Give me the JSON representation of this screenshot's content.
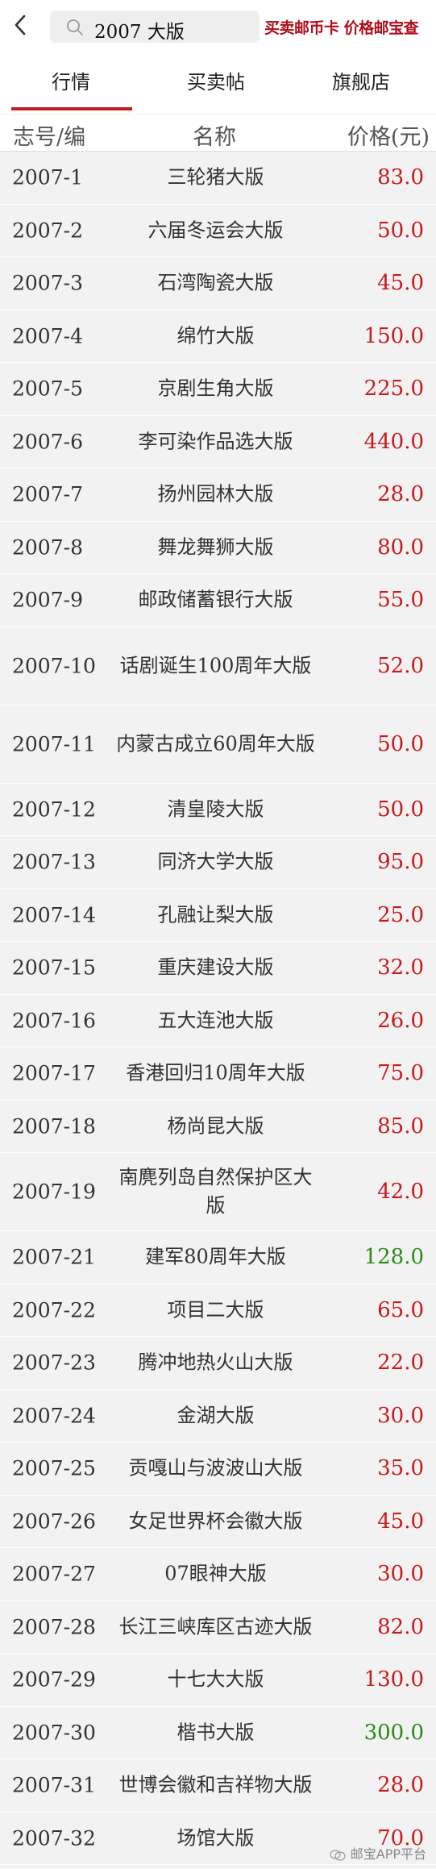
{
  "search": {
    "query": "2007 大版"
  },
  "promo": {
    "text": "买卖邮币卡 价格邮宝查"
  },
  "tabs": [
    {
      "label": "行情"
    },
    {
      "label": "买卖帖"
    },
    {
      "label": "旗舰店"
    }
  ],
  "columns": [
    "志号/编",
    "名称",
    "价格(元)"
  ],
  "rows": [
    {
      "code": "2007-1",
      "name": "三轮猪大版",
      "price": "83.0",
      "color": "red"
    },
    {
      "code": "2007-2",
      "name": "六届冬运会大版",
      "price": "50.0",
      "color": "red"
    },
    {
      "code": "2007-3",
      "name": "石湾陶瓷大版",
      "price": "45.0",
      "color": "red"
    },
    {
      "code": "2007-4",
      "name": "绵竹大版",
      "price": "150.0",
      "color": "red"
    },
    {
      "code": "2007-5",
      "name": "京剧生角大版",
      "price": "225.0",
      "color": "red"
    },
    {
      "code": "2007-6",
      "name": "李可染作品选大版",
      "price": "440.0",
      "color": "red"
    },
    {
      "code": "2007-7",
      "name": "扬州园林大版",
      "price": "28.0",
      "color": "red"
    },
    {
      "code": "2007-8",
      "name": "舞龙舞狮大版",
      "price": "80.0",
      "color": "red"
    },
    {
      "code": "2007-9",
      "name": "邮政储蓄银行大版",
      "price": "55.0",
      "color": "red"
    },
    {
      "code": "2007-10",
      "name": "话剧诞生100周年大版",
      "price": "52.0",
      "color": "red"
    },
    {
      "code": "2007-11",
      "name": "内蒙古成立60周年大版",
      "price": "50.0",
      "color": "red"
    },
    {
      "code": "2007-12",
      "name": "清皇陵大版",
      "price": "50.0",
      "color": "red"
    },
    {
      "code": "2007-13",
      "name": "同济大学大版",
      "price": "95.0",
      "color": "red"
    },
    {
      "code": "2007-14",
      "name": "孔融让梨大版",
      "price": "25.0",
      "color": "red"
    },
    {
      "code": "2007-15",
      "name": "重庆建设大版",
      "price": "32.0",
      "color": "red"
    },
    {
      "code": "2007-16",
      "name": "五大连池大版",
      "price": "26.0",
      "color": "red"
    },
    {
      "code": "2007-17",
      "name": "香港回归10周年大版",
      "price": "75.0",
      "color": "red"
    },
    {
      "code": "2007-18",
      "name": "杨尚昆大版",
      "price": "85.0",
      "color": "red"
    },
    {
      "code": "2007-19",
      "name": "南麂列岛自然保护区大版",
      "price": "42.0",
      "color": "red"
    },
    {
      "code": "2007-21",
      "name": "建军80周年大版",
      "price": "128.0",
      "color": "green"
    },
    {
      "code": "2007-22",
      "name": "项目二大版",
      "price": "65.0",
      "color": "red"
    },
    {
      "code": "2007-23",
      "name": "腾冲地热火山大版",
      "price": "22.0",
      "color": "red"
    },
    {
      "code": "2007-24",
      "name": "金湖大版",
      "price": "30.0",
      "color": "red"
    },
    {
      "code": "2007-25",
      "name": "贡嘎山与波波山大版",
      "price": "35.0",
      "color": "red"
    },
    {
      "code": "2007-26",
      "name": "女足世界杯会徽大版",
      "price": "45.0",
      "color": "red"
    },
    {
      "code": "2007-27",
      "name": "07眼神大版",
      "price": "30.0",
      "color": "red"
    },
    {
      "code": "2007-28",
      "name": "长江三峡库区古迹大版",
      "price": "82.0",
      "color": "red"
    },
    {
      "code": "2007-29",
      "name": "十七大大版",
      "price": "130.0",
      "color": "red"
    },
    {
      "code": "2007-30",
      "name": "楷书大版",
      "price": "300.0",
      "color": "green"
    },
    {
      "code": "2007-31",
      "name": "世博会徽和吉祥物大版",
      "price": "28.0",
      "color": "red"
    },
    {
      "code": "2007-32",
      "name": "场馆大版",
      "price": "70.0",
      "color": "red"
    }
  ],
  "watermark": {
    "text": "邮宝APP平台"
  },
  "colors": {
    "accent": "#c8191c",
    "price_red": "#c8191c",
    "price_green": "#2a8a1a",
    "promo": "#b00d1b"
  },
  "icons": {
    "back": "chevron-left-icon",
    "search": "search-icon",
    "watermark": "wechat-icon"
  }
}
